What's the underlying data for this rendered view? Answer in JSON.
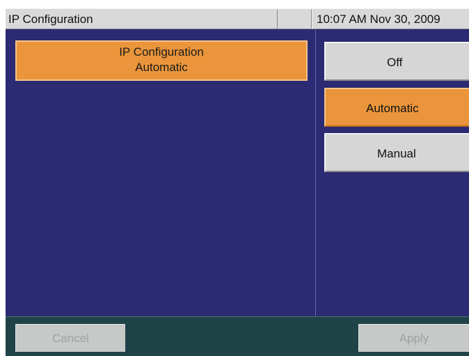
{
  "titlebar": {
    "title": "IP Configuration",
    "clock": "10:07 AM Nov 30, 2009"
  },
  "info_box": {
    "heading": "IP Configuration",
    "value": "Automatic"
  },
  "options": {
    "off_label": "Off",
    "automatic_label": "Automatic",
    "manual_label": "Manual",
    "selected": "Automatic"
  },
  "footer": {
    "cancel_label": "Cancel",
    "apply_label": "Apply"
  },
  "colors": {
    "screen_bg": "#2b2a73",
    "selected": "#ea953b",
    "unselected": "#d6d6d6",
    "footer_bg": "#1f4346"
  }
}
